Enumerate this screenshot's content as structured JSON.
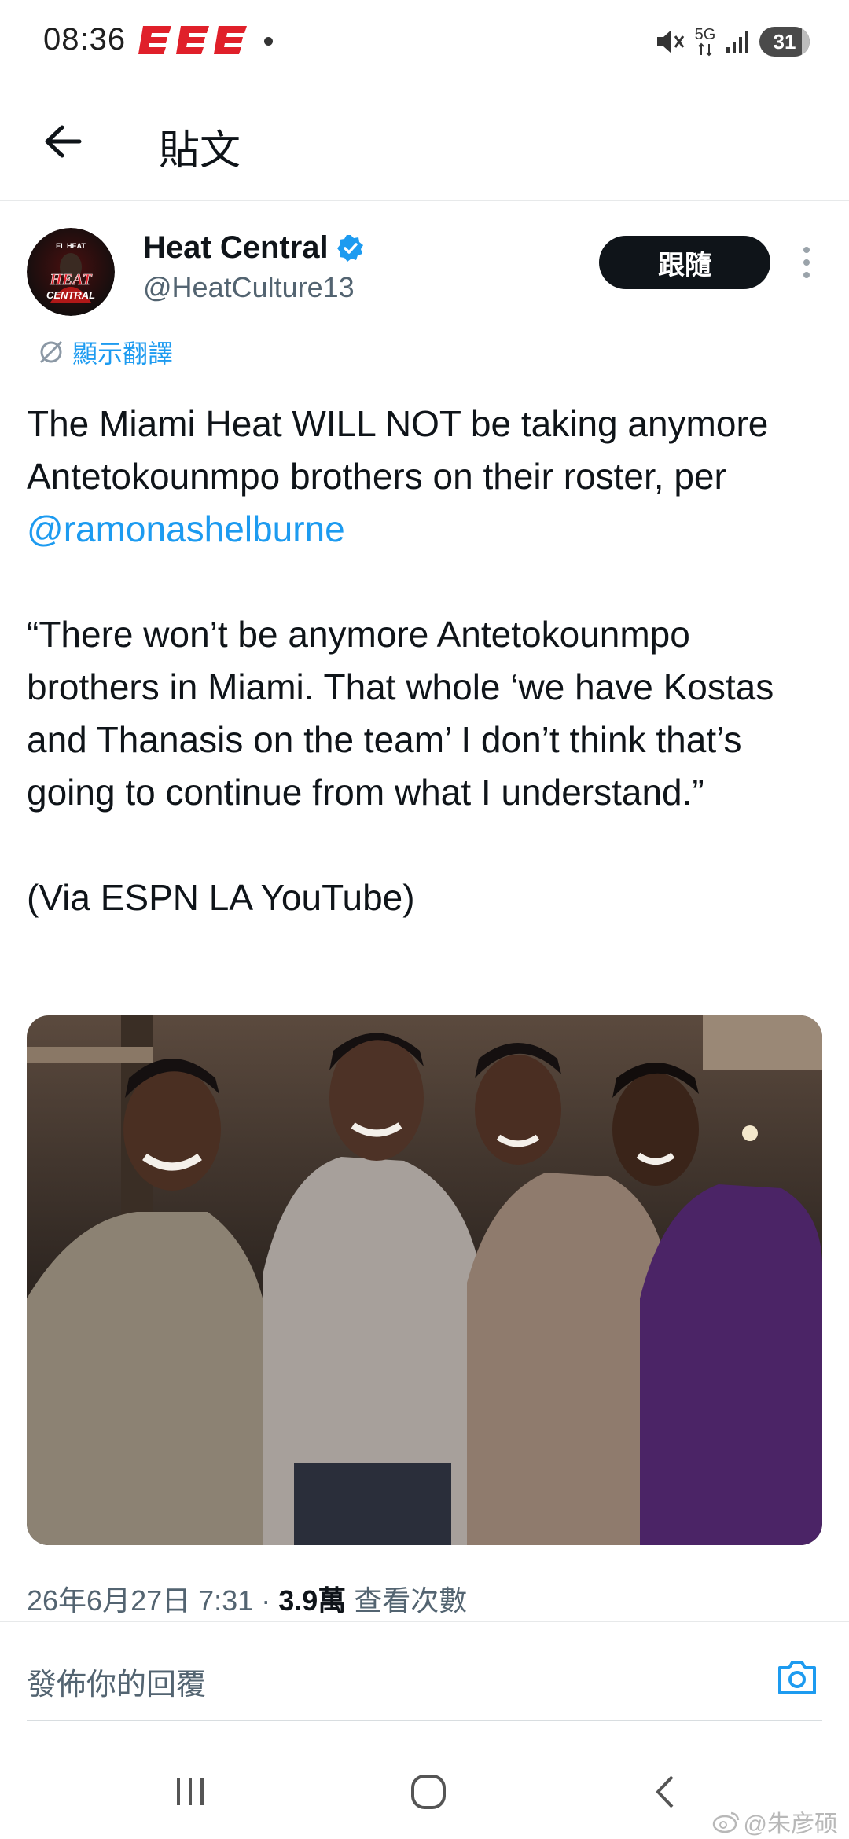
{
  "status_bar": {
    "time": "08:36",
    "network": "5G",
    "battery": "31"
  },
  "header": {
    "title": "貼文"
  },
  "author": {
    "name": "Heat Central",
    "handle": "@HeatCulture13",
    "verified": true,
    "avatar_texts": [
      "EL HEAT",
      "HEAT",
      "CENTRAL"
    ]
  },
  "follow_label": "跟隨",
  "translate_label": "顯示翻譯",
  "tweet": {
    "line1_pre": "The Miami Heat WILL NOT be taking anymore Antetokounmpo brothers on their roster, per ",
    "mention": "@ramonashelburne",
    "quote": "“There won’t be anymore Antetokounmpo brothers in Miami. That whole ‘we have Kostas and Thanasis on the team’ I don’t think that’s going to continue from what I understand.”",
    "via": "(Via ESPN LA YouTube)"
  },
  "meta": {
    "date": "26年6月27日 7:31",
    "separator": "·",
    "views": "3.9萬",
    "views_label": "查看次數"
  },
  "reply": {
    "placeholder": "發佈你的回覆"
  },
  "watermark": "@朱彦硕",
  "colors": {
    "accent": "#1d9bf0",
    "text": "#0f1419",
    "secondary": "#536471",
    "follow_bg": "#0f1419",
    "brand_red": "#e0202a"
  }
}
